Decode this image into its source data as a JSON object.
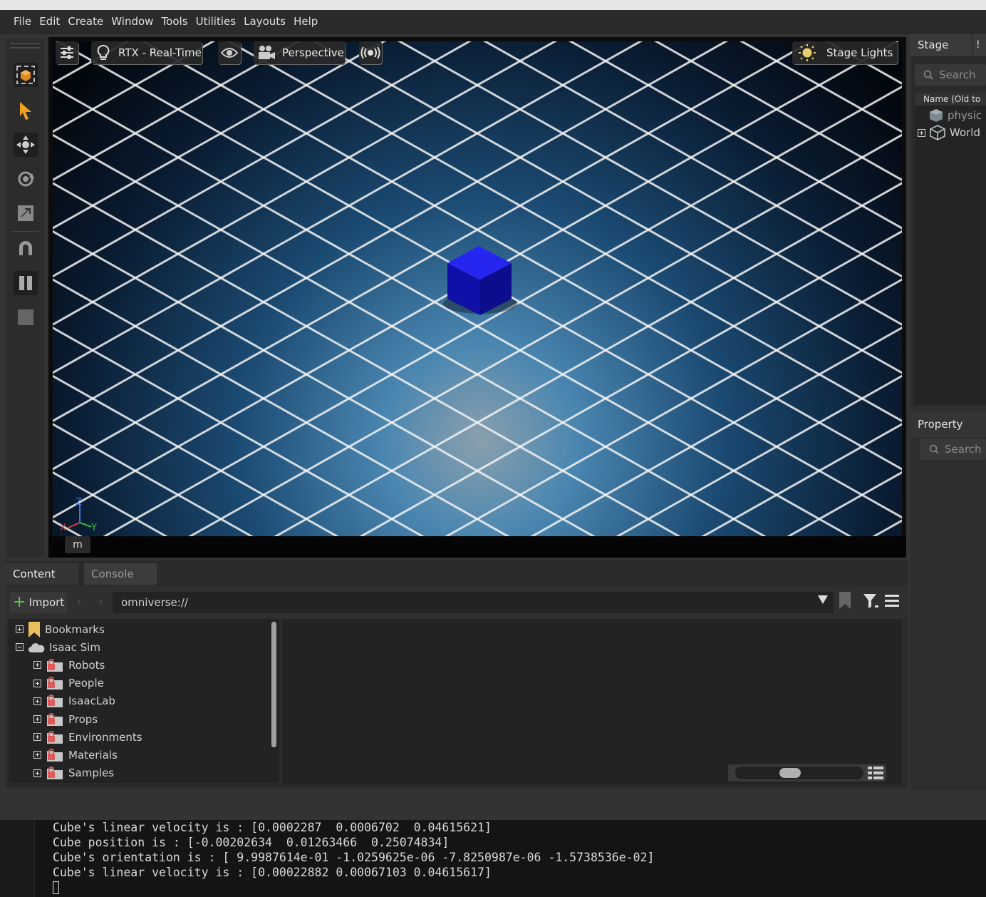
{
  "menu": [
    "File",
    "Edit",
    "Create",
    "Window",
    "Tools",
    "Utilities",
    "Layouts",
    "Help"
  ],
  "viewport": {
    "settings_icon": "sliders-icon",
    "renderer_label": "RTX - Real-Time",
    "camera_label": "Perspective",
    "lights_label": "Stage Lights",
    "bottom_label": "m",
    "axis_labels": {
      "z": "Z",
      "x": "X",
      "y": "Y"
    }
  },
  "tools": [
    "select-mode-icon",
    "arrow-select-icon",
    "move-icon",
    "rotate-icon",
    "scale-icon",
    "snap-magnet-icon",
    "pause-icon",
    "stop-icon"
  ],
  "stage": {
    "title": "Stage",
    "search_placeholder": "Search",
    "column": "Name (Old to",
    "items": [
      {
        "label": "physic",
        "expandable": false
      },
      {
        "label": "World",
        "expandable": true
      }
    ]
  },
  "property": {
    "title": "Property",
    "search_placeholder": "Search"
  },
  "bottom_tabs": [
    "Content",
    "Console"
  ],
  "content": {
    "import_label": "Import",
    "path": "omniverse://",
    "tree": [
      {
        "label": "Bookmarks",
        "level": 0,
        "state": "collapsed",
        "icon": "bookmark-icon"
      },
      {
        "label": "Isaac Sim",
        "level": 0,
        "state": "expanded",
        "icon": "cloud-icon"
      },
      {
        "label": "Robots",
        "level": 1,
        "state": "collapsed",
        "icon": "locked-folder-icon"
      },
      {
        "label": "People",
        "level": 1,
        "state": "collapsed",
        "icon": "locked-folder-icon"
      },
      {
        "label": "IsaacLab",
        "level": 1,
        "state": "collapsed",
        "icon": "locked-folder-icon"
      },
      {
        "label": "Props",
        "level": 1,
        "state": "collapsed",
        "icon": "locked-folder-icon"
      },
      {
        "label": "Environments",
        "level": 1,
        "state": "collapsed",
        "icon": "locked-folder-icon"
      },
      {
        "label": "Materials",
        "level": 1,
        "state": "collapsed",
        "icon": "locked-folder-icon"
      },
      {
        "label": "Samples",
        "level": 1,
        "state": "collapsed",
        "icon": "locked-folder-icon"
      }
    ]
  },
  "terminal": {
    "lines": [
      "Cube's linear velocity is : [0.0002287  0.0006702  0.04615621]",
      "Cube position is : [-0.00202634  0.01263466  0.25074834]",
      "Cube's orientation is : [ 9.9987614e-01 -1.0259625e-06 -7.8250987e-06 -1.5738536e-02]",
      "Cube's linear velocity is : [0.00022882 0.00067103 0.04615617]"
    ]
  },
  "colors": {
    "cube": "#1a1ae0",
    "grid_line": "#f2f2f2",
    "floor_center": "#4a86b0",
    "floor_edge": "#050b14"
  }
}
